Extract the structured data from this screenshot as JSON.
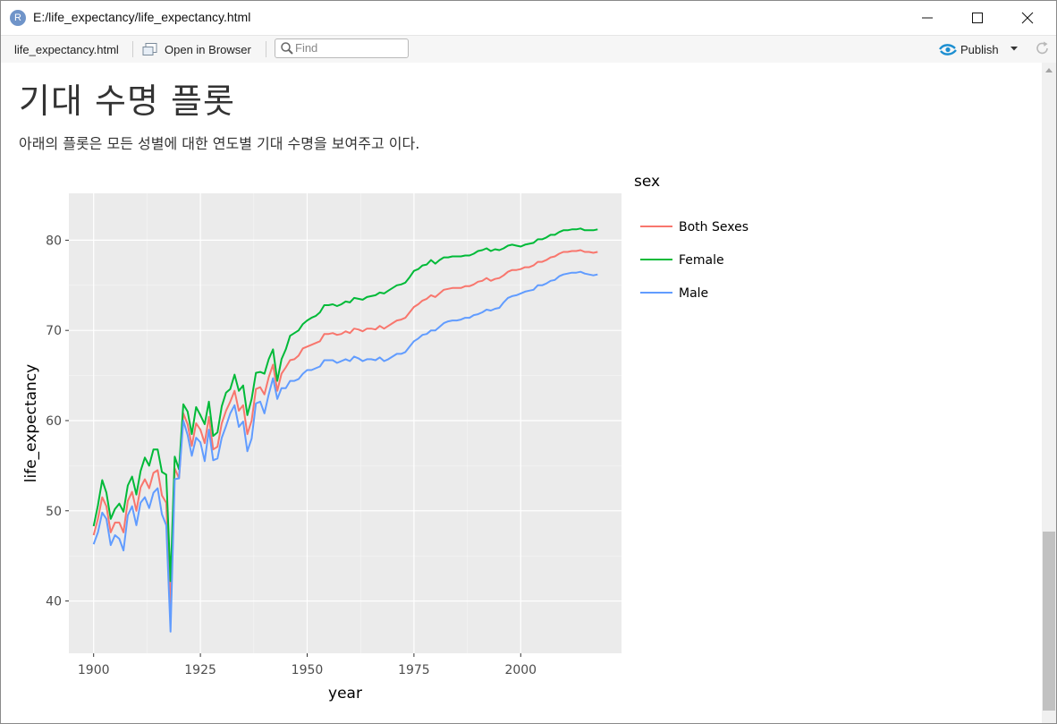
{
  "window": {
    "title": "E:/life_expectancy/life_expectancy.html",
    "app_icon_letter": "R"
  },
  "toolbar": {
    "file_name": "life_expectancy.html",
    "open_in_browser": "Open in Browser",
    "find_placeholder": "Find",
    "publish": "Publish"
  },
  "page": {
    "title": "기대 수명 플롯",
    "description": "아래의 플롯은 모든 성별에 대한 연도별 기대 수명을 보여주고 이다."
  },
  "chart_data": {
    "type": "line",
    "xlabel": "year",
    "ylabel": "life_expectancy",
    "legend_title": "sex",
    "legend_position": "right",
    "grid": true,
    "xlim": [
      1894.2,
      2023.6
    ],
    "ylim": [
      34.2,
      85.2
    ],
    "x_ticks": [
      1900,
      1925,
      1950,
      1975,
      2000
    ],
    "y_ticks": [
      40,
      50,
      60,
      70,
      80
    ],
    "x": [
      1900,
      1901,
      1902,
      1903,
      1904,
      1905,
      1906,
      1907,
      1908,
      1909,
      1910,
      1911,
      1912,
      1913,
      1914,
      1915,
      1916,
      1917,
      1918,
      1919,
      1920,
      1921,
      1922,
      1923,
      1924,
      1925,
      1926,
      1927,
      1928,
      1929,
      1930,
      1931,
      1932,
      1933,
      1934,
      1935,
      1936,
      1937,
      1938,
      1939,
      1940,
      1941,
      1942,
      1943,
      1944,
      1945,
      1946,
      1947,
      1948,
      1949,
      1950,
      1951,
      1952,
      1953,
      1954,
      1955,
      1956,
      1957,
      1958,
      1959,
      1960,
      1961,
      1962,
      1963,
      1964,
      1965,
      1966,
      1967,
      1968,
      1969,
      1970,
      1971,
      1972,
      1973,
      1974,
      1975,
      1976,
      1977,
      1978,
      1979,
      1980,
      1981,
      1982,
      1983,
      1984,
      1985,
      1986,
      1987,
      1988,
      1989,
      1990,
      1991,
      1992,
      1993,
      1994,
      1995,
      1996,
      1997,
      1998,
      1999,
      2000,
      2001,
      2002,
      2003,
      2004,
      2005,
      2006,
      2007,
      2008,
      2009,
      2010,
      2011,
      2012,
      2013,
      2014,
      2015,
      2016,
      2017,
      2018
    ],
    "series": [
      {
        "name": "Both Sexes",
        "color": "#F8766D",
        "values": [
          47.3,
          49.1,
          51.5,
          50.5,
          47.6,
          48.7,
          48.7,
          47.6,
          51.1,
          52.1,
          50.0,
          52.6,
          53.5,
          52.5,
          54.2,
          54.5,
          51.7,
          50.9,
          39.1,
          54.7,
          53.6,
          60.8,
          59.6,
          57.2,
          59.7,
          59.0,
          57.5,
          60.4,
          56.8,
          57.1,
          59.7,
          61.1,
          62.1,
          63.3,
          61.1,
          61.7,
          58.5,
          60.0,
          63.5,
          63.7,
          62.9,
          64.8,
          66.2,
          63.3,
          65.2,
          65.9,
          66.7,
          66.8,
          67.2,
          68.0,
          68.2,
          68.4,
          68.6,
          68.8,
          69.6,
          69.6,
          69.7,
          69.5,
          69.6,
          69.9,
          69.7,
          70.2,
          70.1,
          69.9,
          70.2,
          70.2,
          70.1,
          70.5,
          70.2,
          70.5,
          70.8,
          71.1,
          71.2,
          71.4,
          72.0,
          72.6,
          72.9,
          73.3,
          73.5,
          73.9,
          73.7,
          74.1,
          74.5,
          74.6,
          74.7,
          74.7,
          74.7,
          74.9,
          74.9,
          75.1,
          75.4,
          75.5,
          75.8,
          75.5,
          75.7,
          75.8,
          76.1,
          76.5,
          76.7,
          76.7,
          76.8,
          77.0,
          77.0,
          77.2,
          77.6,
          77.6,
          77.8,
          78.1,
          78.2,
          78.5,
          78.7,
          78.7,
          78.8,
          78.8,
          78.9,
          78.7,
          78.7,
          78.6,
          78.7
        ]
      },
      {
        "name": "Female",
        "color": "#00BA38",
        "values": [
          48.3,
          50.6,
          53.4,
          52.0,
          49.1,
          50.2,
          50.8,
          49.9,
          52.8,
          53.8,
          51.8,
          54.4,
          55.9,
          55.0,
          56.8,
          56.8,
          54.3,
          54.0,
          42.2,
          56.0,
          54.6,
          61.8,
          61.0,
          58.5,
          61.5,
          60.6,
          59.6,
          62.1,
          58.3,
          58.7,
          61.6,
          63.1,
          63.5,
          65.1,
          63.3,
          63.9,
          60.6,
          62.4,
          65.3,
          65.4,
          65.2,
          66.8,
          67.9,
          64.4,
          66.8,
          67.9,
          69.4,
          69.7,
          70.0,
          70.7,
          71.1,
          71.4,
          71.6,
          72.0,
          72.8,
          72.8,
          72.9,
          72.7,
          72.9,
          73.2,
          73.1,
          73.6,
          73.5,
          73.4,
          73.7,
          73.8,
          73.9,
          74.2,
          74.1,
          74.4,
          74.7,
          75.0,
          75.1,
          75.3,
          75.9,
          76.6,
          76.8,
          77.2,
          77.3,
          77.8,
          77.4,
          77.8,
          78.1,
          78.1,
          78.2,
          78.2,
          78.2,
          78.3,
          78.3,
          78.5,
          78.8,
          78.9,
          79.1,
          78.8,
          79.0,
          78.9,
          79.1,
          79.4,
          79.5,
          79.4,
          79.3,
          79.5,
          79.6,
          79.7,
          80.1,
          80.1,
          80.3,
          80.6,
          80.6,
          80.9,
          81.1,
          81.1,
          81.2,
          81.2,
          81.3,
          81.1,
          81.1,
          81.1,
          81.2
        ]
      },
      {
        "name": "Male",
        "color": "#619CFF",
        "values": [
          46.3,
          47.6,
          49.8,
          49.1,
          46.2,
          47.3,
          46.9,
          45.6,
          49.5,
          50.5,
          48.4,
          50.9,
          51.5,
          50.3,
          52.0,
          52.5,
          49.6,
          48.4,
          36.6,
          53.5,
          53.6,
          60.0,
          58.4,
          56.1,
          58.1,
          57.6,
          55.5,
          59.0,
          55.6,
          55.8,
          58.1,
          59.4,
          60.8,
          61.7,
          59.3,
          59.9,
          56.6,
          58.0,
          61.9,
          62.1,
          60.8,
          62.9,
          64.7,
          62.4,
          63.6,
          63.6,
          64.4,
          64.4,
          64.6,
          65.2,
          65.6,
          65.6,
          65.8,
          66.0,
          66.7,
          66.7,
          66.7,
          66.4,
          66.6,
          66.8,
          66.6,
          67.1,
          66.9,
          66.6,
          66.8,
          66.8,
          66.7,
          67.0,
          66.6,
          66.8,
          67.1,
          67.4,
          67.4,
          67.6,
          68.2,
          68.8,
          69.1,
          69.5,
          69.6,
          70.0,
          70.0,
          70.4,
          70.8,
          71.0,
          71.1,
          71.1,
          71.2,
          71.4,
          71.4,
          71.7,
          71.8,
          72.0,
          72.3,
          72.2,
          72.4,
          72.5,
          73.1,
          73.6,
          73.8,
          73.9,
          74.1,
          74.3,
          74.4,
          74.5,
          75.0,
          75.0,
          75.2,
          75.5,
          75.6,
          76.0,
          76.2,
          76.3,
          76.4,
          76.4,
          76.5,
          76.3,
          76.2,
          76.1,
          76.2
        ]
      }
    ]
  }
}
